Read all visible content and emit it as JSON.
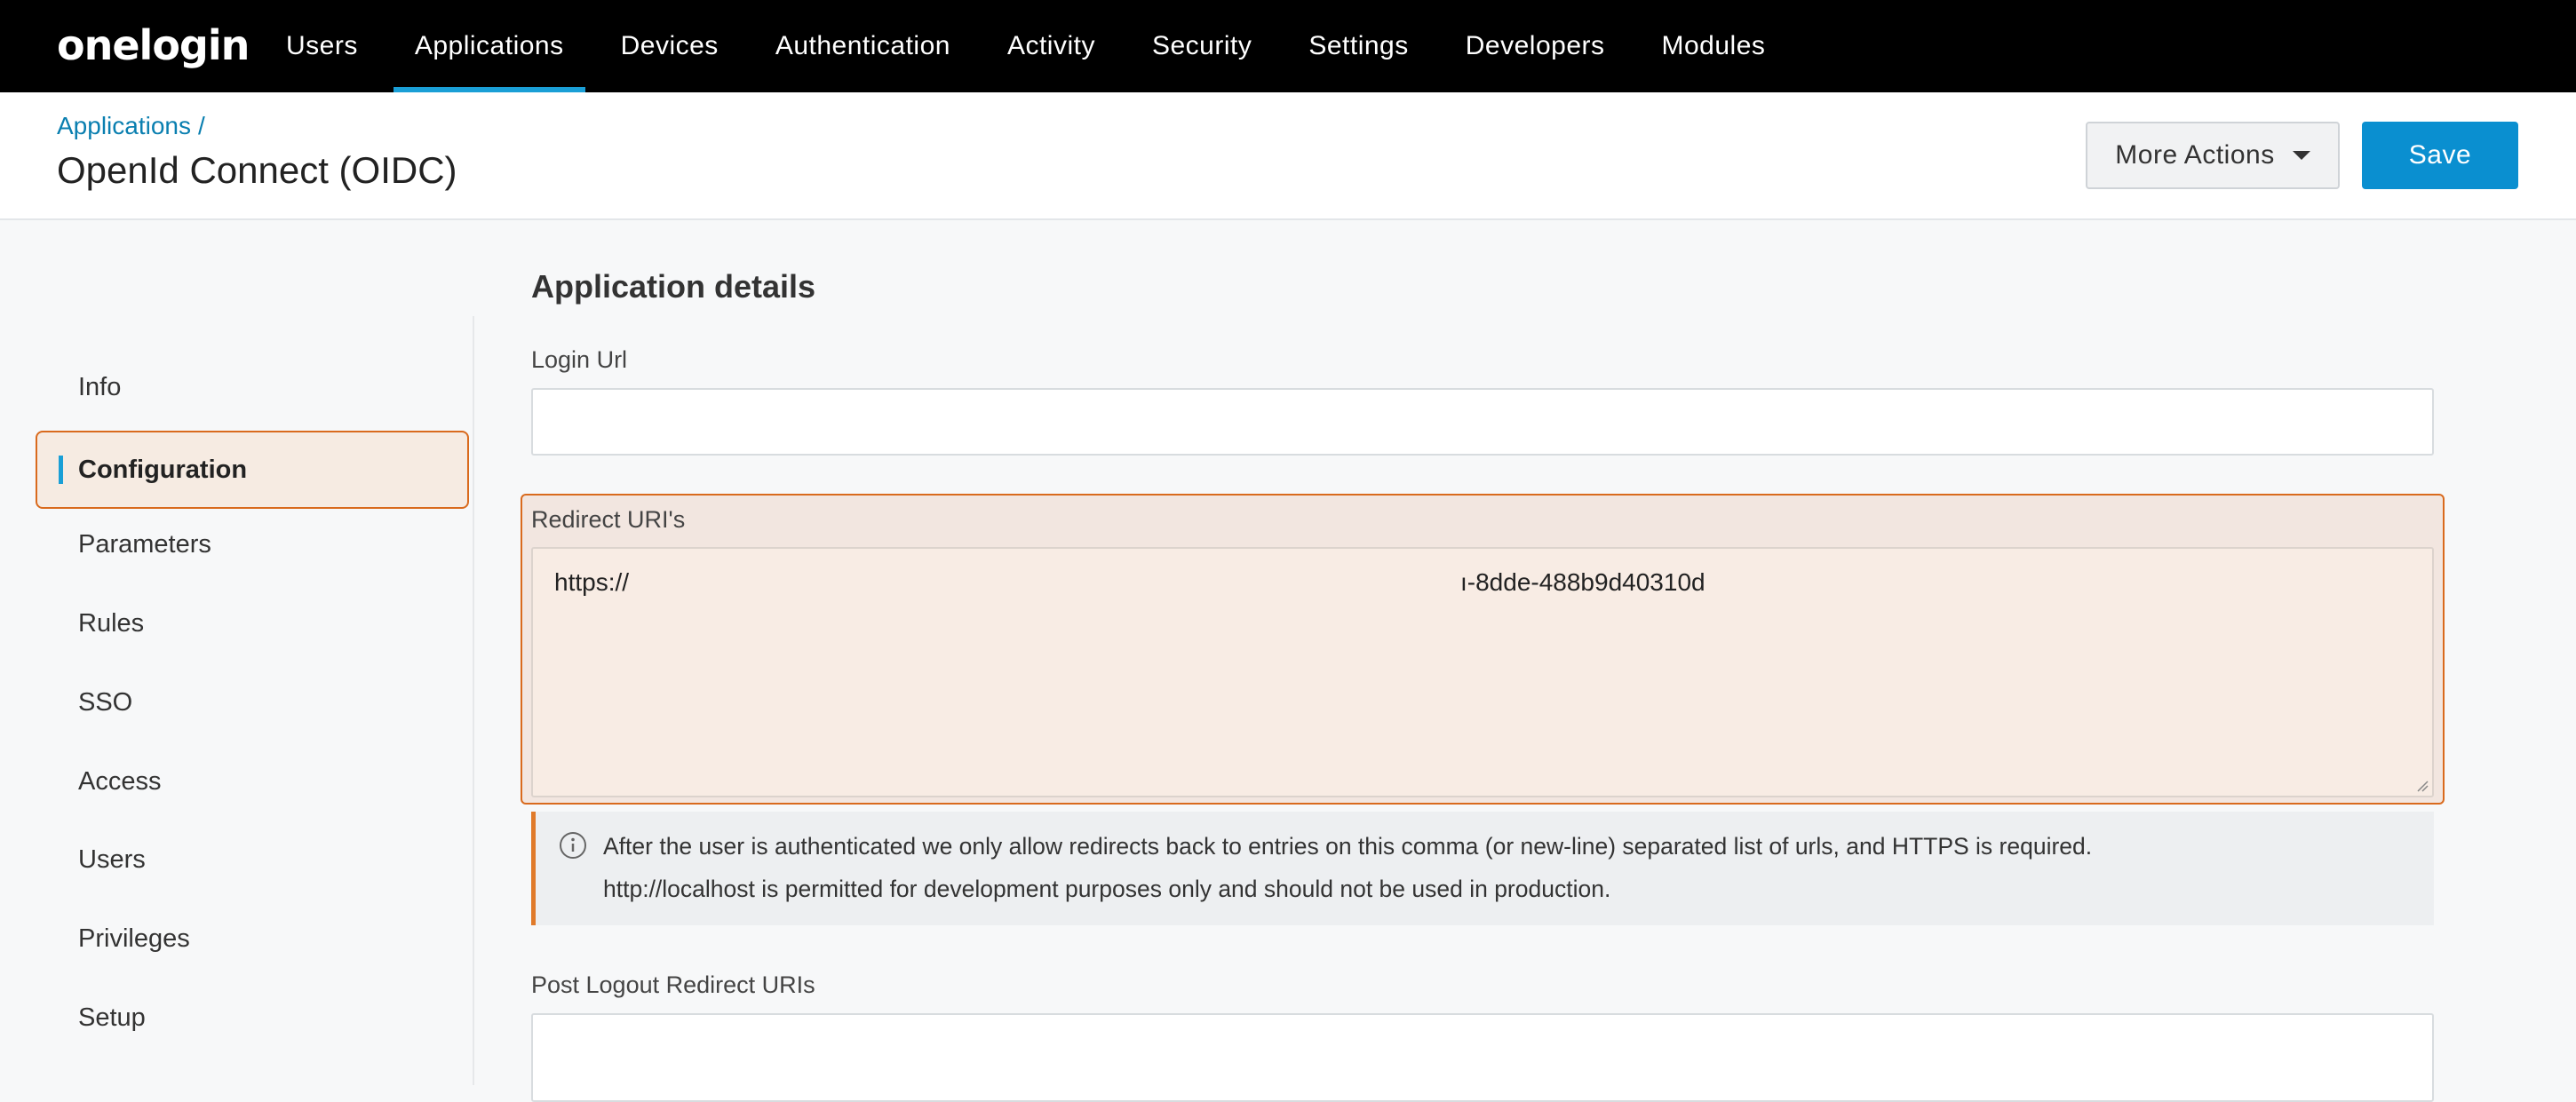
{
  "nav": {
    "logo": "onelogin",
    "items": [
      {
        "label": "Users"
      },
      {
        "label": "Applications"
      },
      {
        "label": "Devices"
      },
      {
        "label": "Authentication"
      },
      {
        "label": "Activity"
      },
      {
        "label": "Security"
      },
      {
        "label": "Settings"
      },
      {
        "label": "Developers"
      },
      {
        "label": "Modules"
      }
    ],
    "active": "Applications"
  },
  "header": {
    "breadcrumb": "Applications",
    "breadcrumb_sep": "/",
    "title": "OpenId Connect (OIDC)",
    "more_actions_label": "More Actions",
    "save_label": "Save"
  },
  "sidebar": {
    "items": [
      {
        "label": "Info"
      },
      {
        "label": "Configuration"
      },
      {
        "label": "Parameters"
      },
      {
        "label": "Rules"
      },
      {
        "label": "SSO"
      },
      {
        "label": "Access"
      },
      {
        "label": "Users"
      },
      {
        "label": "Privileges"
      },
      {
        "label": "Setup"
      }
    ],
    "active": "Configuration"
  },
  "main": {
    "section_title": "Application details",
    "login_url": {
      "label": "Login Url",
      "value": ""
    },
    "redirect_uris": {
      "label": "Redirect URI's",
      "value_start": "https://",
      "value_end": "ı-8dde-488b9d40310d"
    },
    "hint": {
      "line1": "After the user is authenticated we only allow redirects back to entries on this comma (or new-line) separated list of urls, and HTTPS is required.",
      "line2": "http://localhost is permitted for development purposes only and should not be used in production."
    },
    "post_logout": {
      "label": "Post Logout Redirect URIs",
      "value": ""
    }
  },
  "colors": {
    "accent": "#1a9fd6",
    "save_button": "#0a8fd0",
    "highlight_border": "#d96a1d",
    "highlight_bg": "#f6ebe2"
  }
}
